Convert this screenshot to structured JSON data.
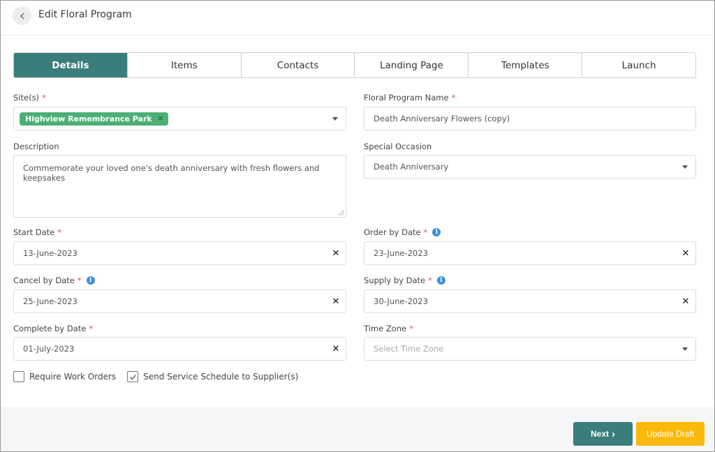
{
  "header": {
    "title": "Edit Floral Program"
  },
  "tabs": [
    {
      "label": "Details",
      "active": true
    },
    {
      "label": "Items",
      "active": false
    },
    {
      "label": "Contacts",
      "active": false
    },
    {
      "label": "Landing Page",
      "active": false
    },
    {
      "label": "Templates",
      "active": false
    },
    {
      "label": "Launch",
      "active": false
    }
  ],
  "form": {
    "sites": {
      "label": "Site(s)",
      "chip": "Highview Remembrance Park"
    },
    "program_name": {
      "label": "Floral Program Name",
      "value": "Death Anniversary Flowers (copy)"
    },
    "description": {
      "label": "Description",
      "value": "Commemorate your loved one's death anniversary with fresh flowers and keepsakes"
    },
    "special_occasion": {
      "label": "Special Occasion",
      "value": "Death Anniversary"
    },
    "start_date": {
      "label": "Start Date",
      "value": "13-June-2023"
    },
    "order_by_date": {
      "label": "Order by Date",
      "value": "23-June-2023"
    },
    "cancel_by_date": {
      "label": "Cancel by Date",
      "value": "25-June-2023"
    },
    "supply_by_date": {
      "label": "Supply by Date",
      "value": "30-June-2023"
    },
    "complete_by_date": {
      "label": "Complete by Date",
      "value": "01-July-2023"
    },
    "time_zone": {
      "label": "Time Zone",
      "placeholder": "Select Time Zone"
    },
    "required_mark": "*",
    "clear_glyph": "✕",
    "info_glyph": "i"
  },
  "checkboxes": [
    {
      "label": "Require Work Orders",
      "checked": false
    },
    {
      "label": "Send Service Schedule to Supplier(s)",
      "checked": true
    }
  ],
  "footer": {
    "next_label": "Next",
    "next_glyph": "›",
    "update_label": "Update Draft"
  },
  "colors": {
    "primary": "#3a7d7b",
    "chip": "#4caf75",
    "warning": "#fbb90c",
    "required": "#d9534f",
    "info": "#3d8fe0"
  }
}
